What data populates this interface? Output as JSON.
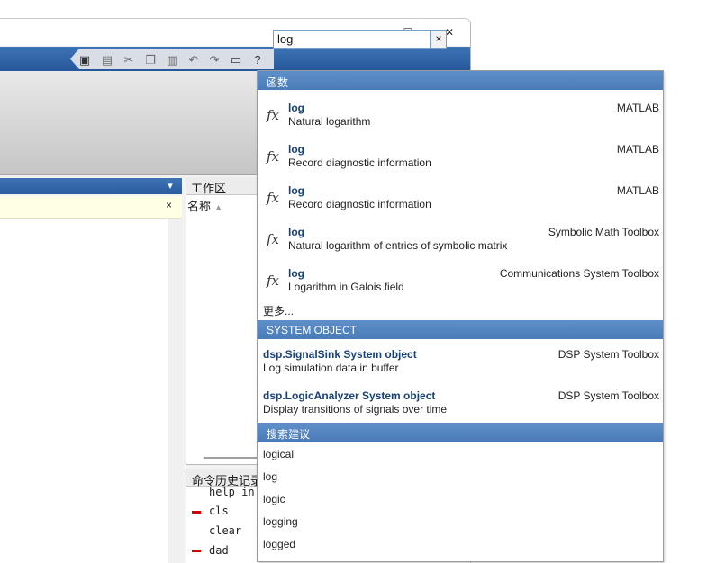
{
  "window": {
    "controls": {
      "minimize": "—",
      "maximize": "☐",
      "close": "✕"
    }
  },
  "search": {
    "value": "log",
    "clear": "×"
  },
  "panels": {
    "workspace_title": "工作区",
    "name_column": "名称",
    "history_title": "命令历史记录"
  },
  "history": [
    {
      "text": "help in",
      "marked": false
    },
    {
      "text": "cls",
      "marked": true
    },
    {
      "text": "clear",
      "marked": false
    },
    {
      "text": "dad",
      "marked": true
    }
  ],
  "dropdown": {
    "functions_header": "函数",
    "functions": [
      {
        "name": "log",
        "desc": "Natural logarithm",
        "source": "MATLAB"
      },
      {
        "name": "log",
        "desc": "Record diagnostic information",
        "source": "MATLAB"
      },
      {
        "name": "log",
        "desc": "Record diagnostic information",
        "source": "MATLAB"
      },
      {
        "name": "log",
        "desc": "Natural logarithm of entries of symbolic matrix",
        "source": "Symbolic Math Toolbox"
      },
      {
        "name": "log",
        "desc": "Logarithm in Galois field",
        "source": "Communications System Toolbox"
      }
    ],
    "more": "更多...",
    "objects_header": "SYSTEM OBJECT",
    "objects": [
      {
        "name": "dsp.SignalSink System object",
        "desc": "Log simulation data in buffer",
        "source": "DSP System Toolbox"
      },
      {
        "name": "dsp.LogicAnalyzer System object",
        "desc": "Display transitions of signals over time",
        "source": "DSP System Toolbox"
      }
    ],
    "suggestions_header": "搜索建议",
    "suggestions": [
      "logical",
      "log",
      "logic",
      "logging",
      "logged"
    ]
  },
  "icons": {
    "fx": "fx",
    "close_x": "×",
    "collapse": "⏶",
    "panel_menu": "▾"
  },
  "colors": {
    "accent_blue": "#2a5c9e",
    "link_blue": "#16427a",
    "history_mark": "#d40000"
  }
}
